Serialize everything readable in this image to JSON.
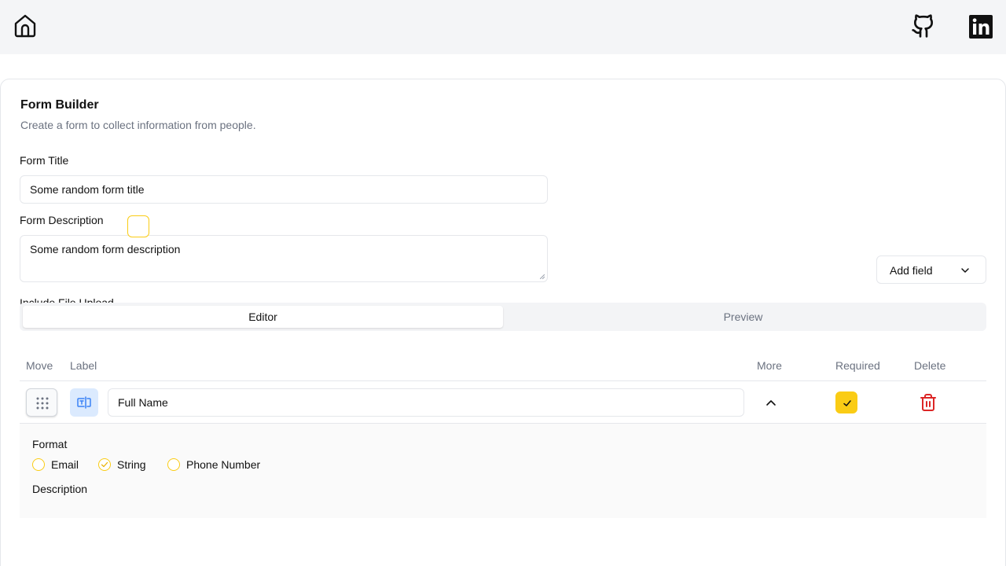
{
  "header": {
    "home_icon": "home-icon",
    "github_icon": "github-icon",
    "linkedin_icon": "linkedin-icon"
  },
  "builder": {
    "title": "Form Builder",
    "description": "Create a form to collect information from people.",
    "form_title_label": "Form Title",
    "form_title_value": "Some random form title",
    "form_description_label": "Form Description",
    "form_description_value": "Some random form description",
    "include_file_upload_label": "Include File Upload",
    "include_file_upload_checked": false,
    "add_field_label": "Add field"
  },
  "tabs": [
    {
      "label": "Editor",
      "active": true
    },
    {
      "label": "Preview",
      "active": false
    }
  ],
  "table": {
    "headers": {
      "move": "Move",
      "label": "Label",
      "more": "More",
      "required": "Required",
      "delete": "Delete"
    },
    "rows": [
      {
        "type_icon": "text-input-icon",
        "label": "Full Name",
        "expanded": true,
        "required": true,
        "format_label": "Format",
        "format_options": [
          {
            "label": "Email",
            "checked": false
          },
          {
            "label": "String",
            "checked": true
          },
          {
            "label": "Phone Number",
            "checked": false
          }
        ],
        "next_section_label": "Description"
      }
    ]
  },
  "colors": {
    "accent": "#facc15",
    "danger": "#dc2626",
    "badge_bg": "#dbeafe",
    "badge_icon": "#3b82f6"
  }
}
